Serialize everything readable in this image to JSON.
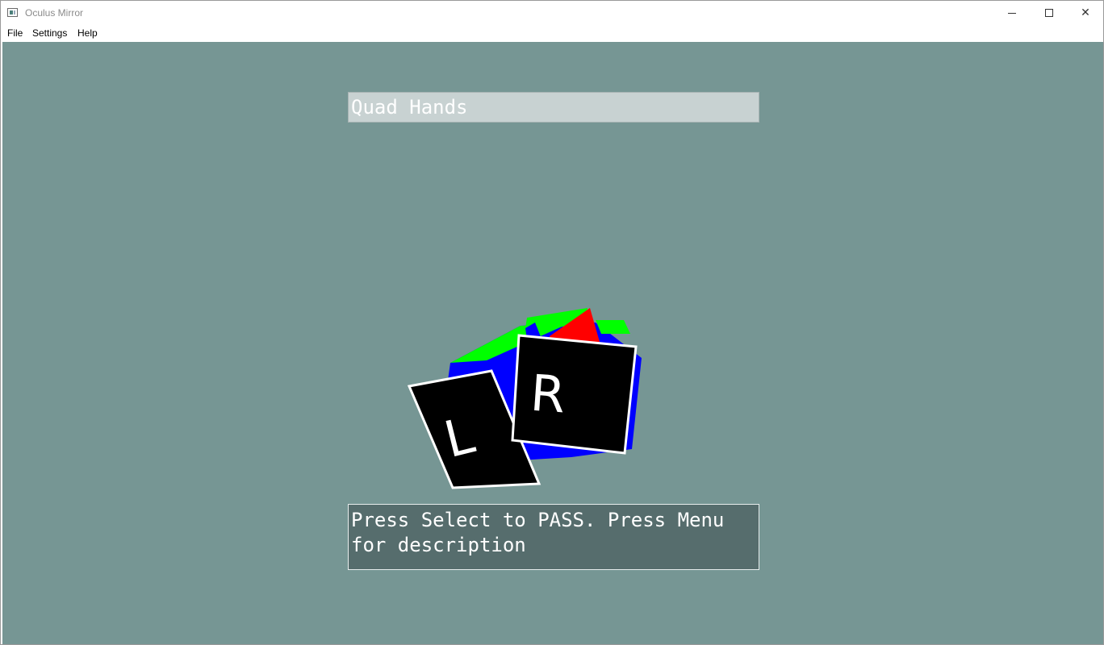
{
  "window": {
    "title": "Oculus Mirror",
    "controls": {
      "minimize": "",
      "maximize": "",
      "close": "✕"
    }
  },
  "menu": {
    "items": [
      {
        "label": "File"
      },
      {
        "label": "Settings"
      },
      {
        "label": "Help"
      }
    ]
  },
  "scene": {
    "title": "Quad Hands",
    "message": "Press Select to PASS. Press Menu for description",
    "left_hand_label": "L",
    "right_hand_label": "R",
    "colors": {
      "background": "#769694",
      "cube_blue": "#0000ff",
      "cube_green": "#00ff00",
      "cube_red": "#ff0000",
      "quad_fill": "#000000",
      "quad_border": "#ffffff"
    }
  }
}
